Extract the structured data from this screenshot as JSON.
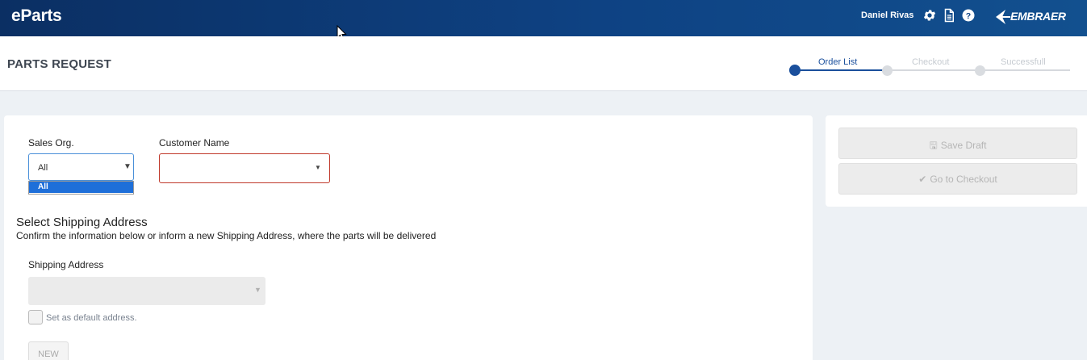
{
  "app": {
    "brand": "eParts",
    "user_name": "Daniel Rivas",
    "company_logo_text": "EMBRAER",
    "icons": [
      "gear-icon",
      "document-icon",
      "help-icon"
    ]
  },
  "header": {
    "title": "PARTS REQUEST",
    "steps": [
      {
        "label": "Order List",
        "state": "active"
      },
      {
        "label": "Checkout",
        "state": "inactive"
      },
      {
        "label": "Successfull",
        "state": "inactive"
      }
    ]
  },
  "form": {
    "sales_org": {
      "label": "Sales Org.",
      "value": "All",
      "open_options": [
        "All"
      ]
    },
    "customer_name": {
      "label": "Customer Name",
      "value": ""
    },
    "shipping": {
      "title": "Select Shipping Address",
      "subtitle": "Confirm the information below or inform a new Shipping Address, where the parts will be delivered",
      "address_label": "Shipping Address",
      "address_value": "",
      "default_checkbox_label": "Set as default address.",
      "new_button": "NEW"
    }
  },
  "actions": {
    "save_draft": "Save Draft",
    "go_to_checkout": "Go to Checkout"
  },
  "colors": {
    "topbar": "#0e4283",
    "accent": "#1a4f9c",
    "error_border": "#c0392b",
    "selected_option": "#1e6fd9"
  }
}
